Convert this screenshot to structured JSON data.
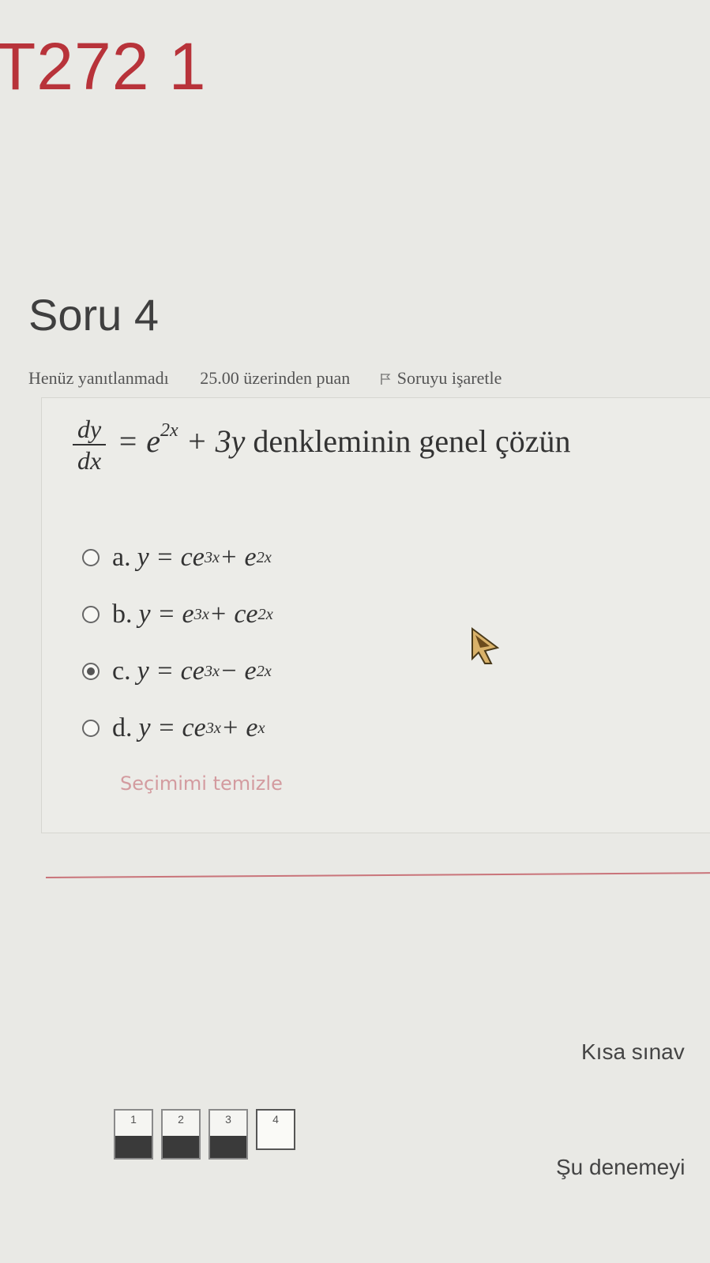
{
  "page": {
    "title": "T272 1"
  },
  "question": {
    "heading": "Soru 4",
    "state": "Henüz yanıtlanmadı",
    "grade": "25.00 üzerinden puan",
    "flag_label": "Soruyu işaretle",
    "stem_lhs_num": "dy",
    "stem_lhs_den": "dx",
    "stem_rhs_pre": "= e",
    "stem_rhs_exp": "2x",
    "stem_rhs_post": " + 3y",
    "stem_text": " denkleminin genel çözün",
    "options": [
      {
        "letter": "a.",
        "pre": "y = ce",
        "exp1": "3x",
        "mid": " + e",
        "exp2": "2x",
        "selected": false
      },
      {
        "letter": "b.",
        "pre": "y = e",
        "exp1": "3x",
        "mid": " + ce",
        "exp2": "2x",
        "selected": false
      },
      {
        "letter": "c.",
        "pre": "y = ce",
        "exp1": "3x",
        "mid": " − e",
        "exp2": "2x",
        "selected": true
      },
      {
        "letter": "d.",
        "pre": "y = ce",
        "exp1": "3x",
        "mid": " + e",
        "exp2": "x",
        "selected": false
      }
    ],
    "clear_choice": "Seçimimi temizle"
  },
  "navigation": {
    "heading": "Kısa sınav",
    "buttons": [
      "1",
      "2",
      "3",
      "4"
    ],
    "finish_link": "Şu denemeyi"
  },
  "colors": {
    "accent": "#b8333a",
    "link_faded": "#d39b9f"
  },
  "icons": {
    "flag": "flag-icon",
    "radio": "radio-icon",
    "cursor": "pointer-cursor-icon"
  }
}
